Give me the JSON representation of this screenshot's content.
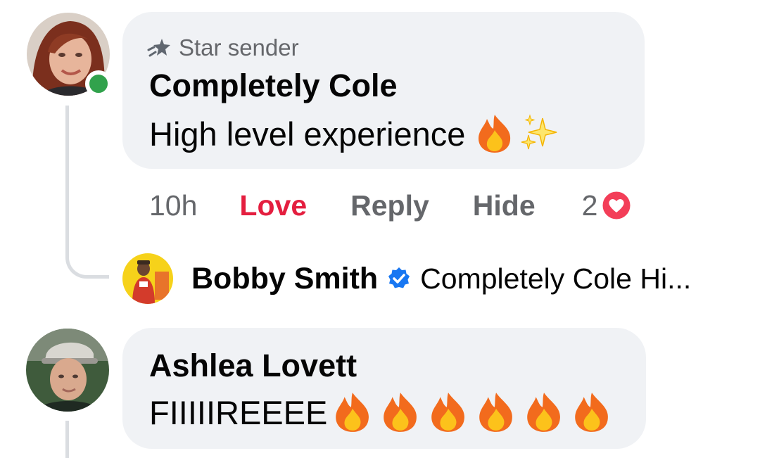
{
  "comment1": {
    "badge": "Star sender",
    "badge_icon": "star-sender-icon",
    "author": "Completely Cole",
    "text": "High level experience",
    "emojis": [
      "🔥",
      "✨"
    ],
    "online": true,
    "time": "10h",
    "actions": [
      "Love",
      "Reply",
      "Hide"
    ],
    "reaction_count": "2",
    "reaction_icon": "love-reaction-icon",
    "love_color": "#e41e3f"
  },
  "reply_preview": {
    "author": "Bobby Smith",
    "verified": true,
    "snippet": "Completely Cole Hi..."
  },
  "comment2": {
    "author": "Ashlea Lovett",
    "text": "FIIIIIREEEE",
    "emojis": [
      "🔥",
      "🔥",
      "🔥",
      "🔥",
      "🔥",
      "🔥"
    ]
  },
  "colors": {
    "bubble": "#f0f2f5",
    "secondary_text": "#65676b",
    "online": "#31a24c",
    "verified": "#1877f2"
  }
}
